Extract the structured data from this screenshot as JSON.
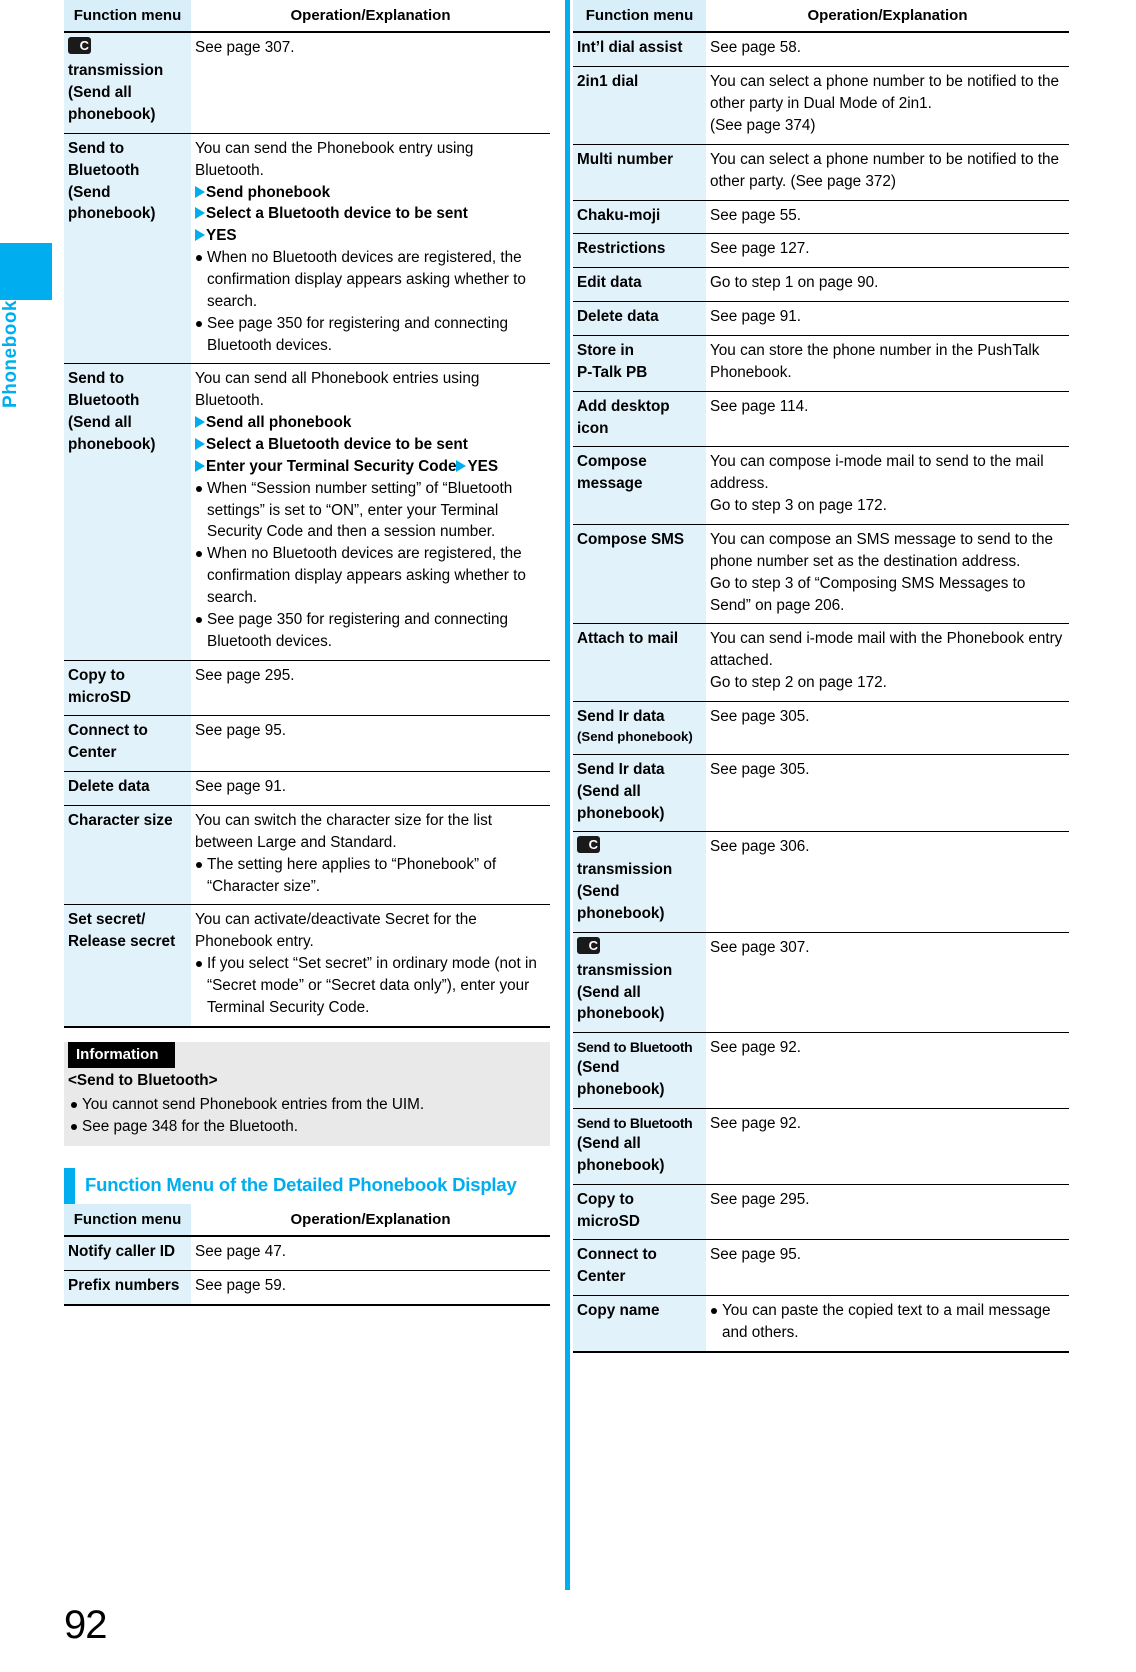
{
  "sidebar": {
    "label": "Phonebook"
  },
  "page_number": "92",
  "table_headers": {
    "function_menu": "Function menu",
    "operation": "Operation/Explanation"
  },
  "icons": {
    "ic_transmission": "ic-transmission-icon"
  },
  "colors": {
    "accent": "#00AEEF",
    "header_cell": "#D8EEF9",
    "first_col": "#E2F2FB",
    "info_bg": "#E9E9E9"
  },
  "left_table_1": {
    "rows": [
      {
        "name_icon": true,
        "name_lines": [
          "transmission",
          "(Send all",
          "phonebook)"
        ],
        "body": [
          {
            "type": "text",
            "text": "See page 307."
          }
        ]
      },
      {
        "name_lines": [
          "Send to",
          "Bluetooth",
          "(Send",
          "phonebook)"
        ],
        "body": [
          {
            "type": "text",
            "text": "You can send the Phonebook entry using"
          },
          {
            "type": "text",
            "text": "Bluetooth."
          },
          {
            "type": "step",
            "text": "Send phonebook"
          },
          {
            "type": "step",
            "text": "Select a Bluetooth device to be sent"
          },
          {
            "type": "step",
            "text": "YES"
          },
          {
            "type": "dot",
            "text": "When no Bluetooth devices are registered, the confirmation display appears asking whether to search."
          },
          {
            "type": "dot",
            "text": "See page 350 for registering and connecting Bluetooth devices."
          }
        ]
      },
      {
        "name_lines": [
          "Send to",
          "Bluetooth",
          "(Send all",
          "phonebook)"
        ],
        "body": [
          {
            "type": "text",
            "text": "You can send all Phonebook entries using"
          },
          {
            "type": "text",
            "text": "Bluetooth."
          },
          {
            "type": "step",
            "text": "Send all phonebook"
          },
          {
            "type": "step",
            "text": "Select a Bluetooth device to be sent"
          },
          {
            "type": "step2",
            "text": "Enter your Terminal Security Code",
            "text2": "YES"
          },
          {
            "type": "dot",
            "text": "When “Session number setting” of “Bluetooth settings” is set to “ON”, enter your Terminal Security Code and then a session number."
          },
          {
            "type": "dot",
            "text": "When no Bluetooth devices are registered, the confirmation display appears asking whether to search."
          },
          {
            "type": "dot",
            "text": "See page 350 for registering and connecting Bluetooth devices."
          }
        ]
      },
      {
        "name_lines": [
          "Copy to",
          "microSD"
        ],
        "body": [
          {
            "type": "text",
            "text": "See page 295."
          }
        ]
      },
      {
        "name_lines": [
          "Connect to",
          "Center"
        ],
        "body": [
          {
            "type": "text",
            "text": "See page 95."
          }
        ]
      },
      {
        "name_lines": [
          "Delete data"
        ],
        "body": [
          {
            "type": "text",
            "text": "See page 91."
          }
        ]
      },
      {
        "name_lines": [
          "Character size"
        ],
        "body": [
          {
            "type": "text",
            "text": "You can switch the character size for the list between Large and Standard."
          },
          {
            "type": "dot",
            "text": "The setting here applies to “Phonebook” of “Character size”."
          }
        ]
      },
      {
        "name_lines": [
          "Set secret/",
          "Release secret"
        ],
        "body": [
          {
            "type": "text",
            "text": "You can activate/deactivate Secret for the Phonebook entry."
          },
          {
            "type": "dot",
            "text": "If you select “Set secret” in ordinary mode (not in “Secret mode” or “Secret data only”), enter your Terminal Security Code."
          }
        ]
      }
    ]
  },
  "information": {
    "tag": "Information",
    "subtitle": "<Send to Bluetooth>",
    "bullets": [
      "You cannot send Phonebook entries from the UIM.",
      "See page 348 for the Bluetooth."
    ]
  },
  "section_heading": {
    "text": "Function Menu of the Detailed Phonebook Display"
  },
  "left_table_2": {
    "rows": [
      {
        "name_lines": [
          "Notify caller ID"
        ],
        "body": [
          {
            "type": "text",
            "text": "See page 47."
          }
        ]
      },
      {
        "name_lines": [
          "Prefix numbers"
        ],
        "body": [
          {
            "type": "text",
            "text": "See page 59."
          }
        ]
      }
    ]
  },
  "right_table": {
    "rows": [
      {
        "name_lines": [
          "Int’l dial assist"
        ],
        "body": [
          {
            "type": "text",
            "text": "See page 58."
          }
        ]
      },
      {
        "name_lines": [
          "2in1 dial"
        ],
        "body": [
          {
            "type": "text",
            "text": "You can select a phone number to be notified to the other party in Dual Mode of 2in1."
          },
          {
            "type": "text",
            "text": "(See page 374)"
          }
        ]
      },
      {
        "name_lines": [
          "Multi number"
        ],
        "body": [
          {
            "type": "text",
            "text": "You can select a phone number to be notified to the other party. (See page 372)"
          }
        ]
      },
      {
        "name_lines": [
          "Chaku-moji"
        ],
        "body": [
          {
            "type": "text",
            "text": "See page 55."
          }
        ]
      },
      {
        "name_lines": [
          "Restrictions"
        ],
        "body": [
          {
            "type": "text",
            "text": "See page 127."
          }
        ]
      },
      {
        "name_lines": [
          "Edit data"
        ],
        "body": [
          {
            "type": "text",
            "text": "Go to step 1 on page 90."
          }
        ]
      },
      {
        "name_lines": [
          "Delete data"
        ],
        "body": [
          {
            "type": "text",
            "text": "See page 91."
          }
        ]
      },
      {
        "name_lines": [
          "Store in",
          "P-Talk PB"
        ],
        "body": [
          {
            "type": "text",
            "text": "You can store the phone number in the PushTalk Phonebook."
          }
        ]
      },
      {
        "name_lines": [
          "Add desktop",
          "icon"
        ],
        "body": [
          {
            "type": "text",
            "text": "See page 114."
          }
        ]
      },
      {
        "name_lines": [
          "Compose",
          "message"
        ],
        "body": [
          {
            "type": "text",
            "text": "You can compose i-mode mail to send to the mail address."
          },
          {
            "type": "text",
            "text": "Go to step 3 on page 172."
          }
        ]
      },
      {
        "name_lines": [
          "Compose SMS"
        ],
        "body": [
          {
            "type": "text",
            "text": "You can compose an SMS message to send to the phone number set as the destination address."
          },
          {
            "type": "text",
            "text": "Go to step 3 of “Composing SMS Messages to Send” on page 206."
          }
        ]
      },
      {
        "name_lines": [
          "Attach to mail"
        ],
        "body": [
          {
            "type": "text",
            "text": "You can send i-mode mail with the Phonebook entry attached."
          },
          {
            "type": "text",
            "text": "Go to step 2 on page 172."
          }
        ]
      },
      {
        "name_lines": [
          "Send Ir data"
        ],
        "name_small": [
          "(Send phonebook)"
        ],
        "body": [
          {
            "type": "text",
            "text": "See page 305."
          }
        ]
      },
      {
        "name_lines": [
          "Send Ir data",
          "(Send all",
          "phonebook)"
        ],
        "body": [
          {
            "type": "text",
            "text": "See page 305."
          }
        ]
      },
      {
        "name_icon": true,
        "name_lines": [
          "transmission",
          "(Send",
          "phonebook)"
        ],
        "body": [
          {
            "type": "text",
            "text": "See page 306."
          }
        ]
      },
      {
        "name_icon": true,
        "name_lines": [
          "transmission",
          "(Send all",
          "phonebook)"
        ],
        "body": [
          {
            "type": "text",
            "text": "See page 307."
          }
        ]
      },
      {
        "name_cond": [
          "Send to Bluetooth"
        ],
        "name_lines": [
          "(Send",
          "phonebook)"
        ],
        "body": [
          {
            "type": "text",
            "text": "See page 92."
          }
        ]
      },
      {
        "name_cond": [
          "Send to Bluetooth"
        ],
        "name_lines": [
          "(Send all",
          "phonebook)"
        ],
        "body": [
          {
            "type": "text",
            "text": "See page 92."
          }
        ]
      },
      {
        "name_lines": [
          "Copy to",
          "microSD"
        ],
        "body": [
          {
            "type": "text",
            "text": "See page 295."
          }
        ]
      },
      {
        "name_lines": [
          "Connect to",
          "Center"
        ],
        "body": [
          {
            "type": "text",
            "text": "See page 95."
          }
        ]
      },
      {
        "name_lines": [
          "Copy name"
        ],
        "body": [
          {
            "type": "dot",
            "text": "You can paste the copied text to a mail message and others."
          }
        ]
      }
    ]
  }
}
